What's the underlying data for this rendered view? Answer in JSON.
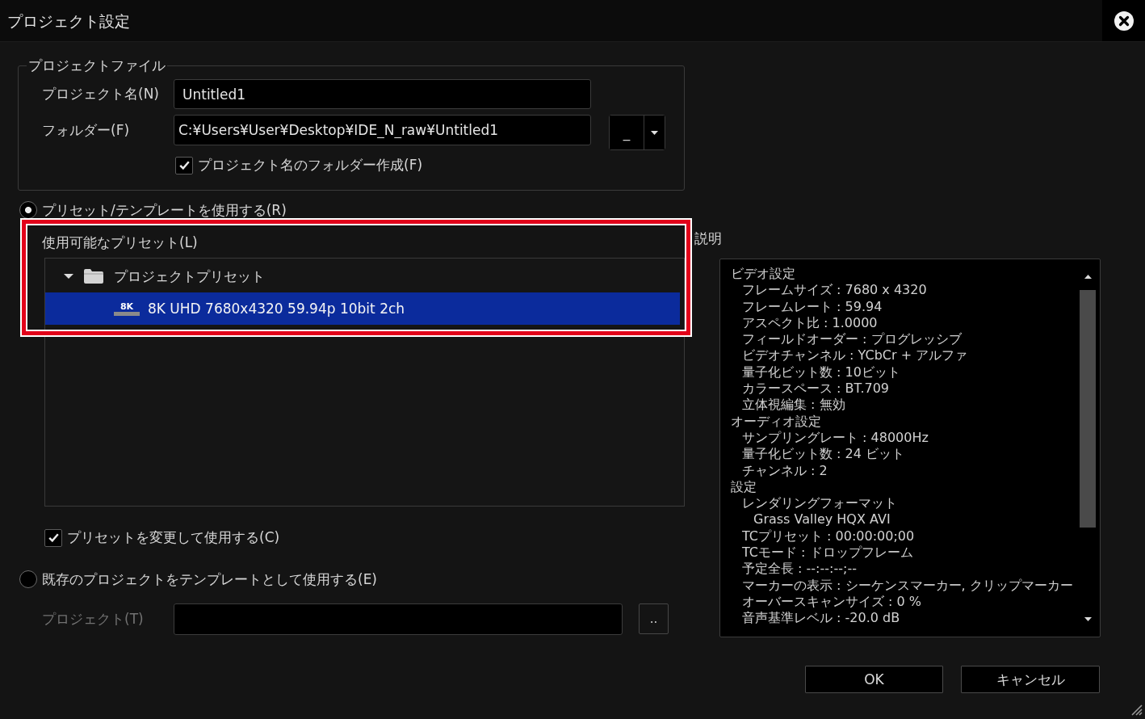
{
  "window": {
    "title": "プロジェクト設定"
  },
  "project_file": {
    "legend": "プロジェクトファイル",
    "fields": [
      {
        "label": "プロジェクト名(N)",
        "value": "Untitled1",
        "kind": "text"
      },
      {
        "label": "フォルダー(F)",
        "value": "C:¥Users¥User¥Desktop¥IDE_N_raw¥Untitled1",
        "kind": "folder",
        "browse": "_"
      }
    ],
    "create_folder": {
      "label": "プロジェクト名のフォルダー作成(F)",
      "checked": true
    }
  },
  "use_preset": {
    "label": "プリセット/テンプレートを使用する(R)",
    "selected": true
  },
  "presets": {
    "label": "使用可能なプリセット(L)",
    "highlighted": true,
    "tree": [
      {
        "label": "プロジェクトプリセット",
        "kind": "folder",
        "expanded": true,
        "selected": false,
        "children": [
          {
            "label": "8K UHD 7680x4320 59.94p 10bit 2ch",
            "kind": "preset",
            "badge": "8K",
            "selected": true
          }
        ]
      }
    ]
  },
  "modify_preset": {
    "label": "プリセットを変更して使用する(C)",
    "checked": true
  },
  "use_existing": {
    "label": "既存のプロジェクトをテンプレートとして使用する(E)",
    "selected": false
  },
  "template_project": {
    "label": "プロジェクト(T)",
    "disabled": true,
    "browse": ".."
  },
  "description": {
    "label": "説明",
    "lines": [
      {
        "text": "ビデオ設定",
        "children": [
          {
            "text": "フレームサイズ : 7680 x 4320"
          },
          {
            "text": "フレームレート : 59.94"
          },
          {
            "text": "アスペクト比 : 1.0000"
          },
          {
            "text": "フィールドオーダー : プログレッシブ"
          },
          {
            "text": "ビデオチャンネル : YCbCr + アルファ"
          },
          {
            "text": "量子化ビット数 : 10ビット"
          },
          {
            "text": "カラースペース : BT.709"
          },
          {
            "text": "立体視編集 : 無効"
          }
        ]
      },
      {
        "text": "オーディオ設定",
        "children": [
          {
            "text": "サンプリングレート : 48000Hz"
          },
          {
            "text": "量子化ビット数 : 24 ビット"
          },
          {
            "text": "チャンネル : 2"
          }
        ]
      },
      {
        "text": "設定",
        "children": [
          {
            "text": "レンダリングフォーマット",
            "children": [
              {
                "text": "Grass Valley HQX AVI"
              }
            ]
          },
          {
            "text": "TCプリセット : 00:00:00;00"
          },
          {
            "text": "TCモード : ドロップフレーム"
          },
          {
            "text": "予定全長 : --:--:--;--"
          },
          {
            "text": "マーカーの表示 : シーケンスマーカー, クリップマーカー"
          },
          {
            "text": "オーバースキャンサイズ : 0 %"
          },
          {
            "text": "音声基準レベル : -20.0 dB"
          }
        ]
      }
    ]
  },
  "buttons": [
    {
      "label": "OK"
    },
    {
      "label": "キャンセル"
    }
  ]
}
